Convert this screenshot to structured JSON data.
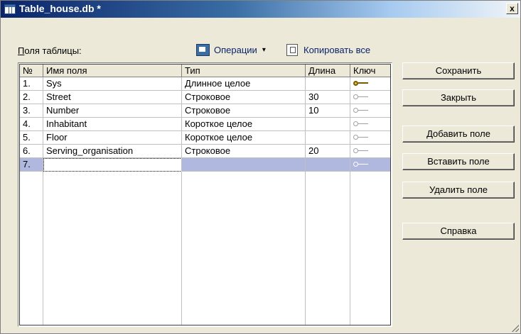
{
  "window": {
    "title": "Table_house.db *",
    "close_label": "x"
  },
  "toolbar": {
    "fields_label_prefix": "П",
    "fields_label_rest": "оля таблицы:",
    "operations_label": "Операции",
    "operations_caret": "▾",
    "copy_all_label": "Копировать все"
  },
  "table": {
    "columns": [
      "№",
      "Имя поля",
      "Тип",
      "Длина",
      "Ключ"
    ],
    "rows": [
      {
        "num": "1.",
        "name": "Sys",
        "type": "Длинное целое",
        "length": "",
        "key": true
      },
      {
        "num": "2.",
        "name": "Street",
        "type": "Строковое",
        "length": "30",
        "key": false
      },
      {
        "num": "3.",
        "name": "Number",
        "type": "Строковое",
        "length": "10",
        "key": false
      },
      {
        "num": "4.",
        "name": "Inhabitant",
        "type": "Короткое целое",
        "length": "",
        "key": false
      },
      {
        "num": "5.",
        "name": "Floor",
        "type": "Короткое целое",
        "length": "",
        "key": false
      },
      {
        "num": "6.",
        "name": "Serving_organisation",
        "type": "Строковое",
        "length": "20",
        "key": false
      },
      {
        "num": "7.",
        "name": "",
        "type": "",
        "length": "",
        "key": false,
        "selected": true
      }
    ]
  },
  "buttons": {
    "save": "Сохранить",
    "close": "Закрыть",
    "add_field": "Добавить поле",
    "insert_field": "Вставить поле",
    "delete_field": "Удалить поле",
    "help": "Справка"
  },
  "icons": {
    "title": "table-icon",
    "operations": "operations-icon",
    "copy": "copy-icon",
    "key": "key-icon"
  },
  "colors": {
    "title_start": "#0a246a",
    "title_end": "#a6caf0",
    "selection": "#b0b8e0",
    "face": "#ece9d8"
  }
}
